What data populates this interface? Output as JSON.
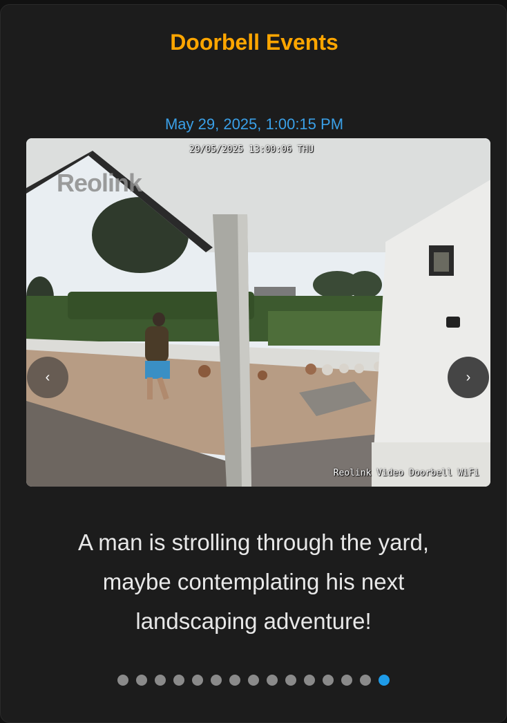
{
  "card": {
    "title": "Doorbell Events",
    "title_color": "#ffa600"
  },
  "event": {
    "timestamp": "May 29, 2025, 1:00:15 PM",
    "caption": "A man is strolling through the yard, maybe contemplating his next landscaping adventure!"
  },
  "camera_image": {
    "osd_timestamp": "29/05/2025 13:00:06 THU",
    "osd_model": "Reolink Video Doorbell WiFi",
    "watermark": "Reolink"
  },
  "navigation": {
    "prev_label": "‹",
    "next_label": "›"
  },
  "pagination": {
    "total": 15,
    "active_index": 14,
    "active_color": "#1e9be8",
    "inactive_color": "#8a8a8a"
  }
}
